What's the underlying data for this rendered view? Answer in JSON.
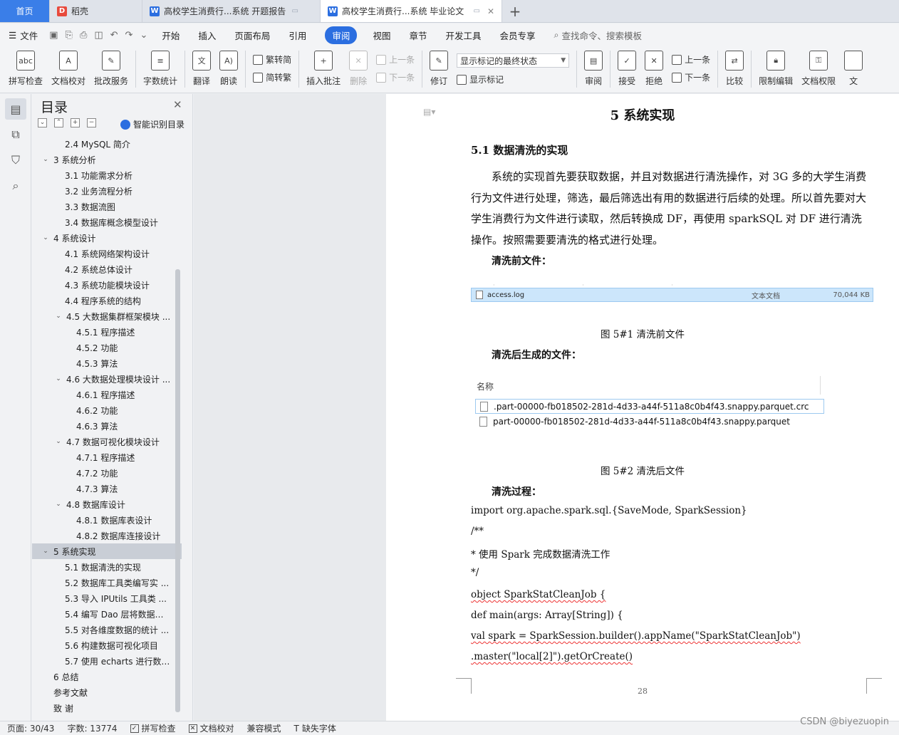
{
  "tabs": {
    "home": "首页",
    "wps": "稻壳",
    "doc1": "高校学生消费行...系统 开题报告",
    "doc2": "高校学生消费行...系统 毕业论文",
    "add": "+"
  },
  "menu": {
    "file": "文件",
    "items": [
      "开始",
      "插入",
      "页面布局",
      "引用",
      "审阅",
      "视图",
      "章节",
      "开发工具",
      "会员专享"
    ],
    "active_index": 4,
    "search": "查找命令、搜索模板"
  },
  "ribbon": {
    "spell": "拼写检查",
    "doc_check": "文档校对",
    "revise_service": "批改服务",
    "word_count": "字数统计",
    "translate": "翻译",
    "read_aloud": "朗读",
    "to_trad": "繁转简",
    "to_simp": "简转繁",
    "insert_comment": "插入批注",
    "delete": "删除",
    "prev": "上一条",
    "next": "下一条",
    "revise": "修订",
    "display_mode": "显示标记的最终状态",
    "show_markup": "显示标记",
    "review": "审阅",
    "accept": "接受",
    "reject": "拒绝",
    "prev2": "上一条",
    "next2": "下一条",
    "compare": "比较",
    "restrict": "限制编辑",
    "doc_perm": "文档权限",
    "doc_cut": "文"
  },
  "toc": {
    "title": "目录",
    "smart": "智能识别目录",
    "items": [
      {
        "level": 2,
        "text": "2.4 MySQL 简介",
        "toggle": ""
      },
      {
        "level": 1,
        "text": "3  系统分析",
        "toggle": "v"
      },
      {
        "level": 2,
        "text": "3.1  功能需求分析",
        "toggle": ""
      },
      {
        "level": 2,
        "text": "3.2  业务流程分析",
        "toggle": ""
      },
      {
        "level": 2,
        "text": "3.3  数据流图",
        "toggle": ""
      },
      {
        "level": 2,
        "text": "3.4  数据库概念模型设计",
        "toggle": ""
      },
      {
        "level": 1,
        "text": "4  系统设计",
        "toggle": "v"
      },
      {
        "level": 2,
        "text": "4.1  系统网络架构设计",
        "toggle": ""
      },
      {
        "level": 2,
        "text": "4.2  系统总体设计",
        "toggle": ""
      },
      {
        "level": 2,
        "text": "4.3  系统功能模块设计",
        "toggle": ""
      },
      {
        "level": 2,
        "text": "4.4  程序系统的结构",
        "toggle": ""
      },
      {
        "level": 2,
        "text": "4.5  大数据集群框架模块 ...",
        "toggle": "v"
      },
      {
        "level": 3,
        "text": "4.5.1  程序描述",
        "toggle": ""
      },
      {
        "level": 3,
        "text": "4.5.2  功能",
        "toggle": ""
      },
      {
        "level": 3,
        "text": "4.5.3  算法",
        "toggle": ""
      },
      {
        "level": 2,
        "text": "4.6  大数据处理模块设计 ...",
        "toggle": "v"
      },
      {
        "level": 3,
        "text": "4.6.1  程序描述",
        "toggle": ""
      },
      {
        "level": 3,
        "text": "4.6.2  功能",
        "toggle": ""
      },
      {
        "level": 3,
        "text": "4.6.3  算法",
        "toggle": ""
      },
      {
        "level": 2,
        "text": "4.7  数据可视化模块设计",
        "toggle": "v"
      },
      {
        "level": 3,
        "text": "4.7.1  程序描述",
        "toggle": ""
      },
      {
        "level": 3,
        "text": "4.7.2  功能",
        "toggle": ""
      },
      {
        "level": 3,
        "text": "4.7.3  算法",
        "toggle": ""
      },
      {
        "level": 2,
        "text": "4.8  数据库设计",
        "toggle": "v"
      },
      {
        "level": 3,
        "text": "4.8.1  数据库表设计",
        "toggle": ""
      },
      {
        "level": 3,
        "text": "4.8.2  数据库连接设计",
        "toggle": ""
      },
      {
        "level": 1,
        "text": "5  系统实现",
        "toggle": "v",
        "selected": true
      },
      {
        "level": 2,
        "text": "5.1  数据清洗的实现",
        "toggle": ""
      },
      {
        "level": 2,
        "text": "5.2  数据库工具类编写实 ...",
        "toggle": ""
      },
      {
        "level": 2,
        "text": "5.3 导入 IPUtils 工具类 ...",
        "toggle": ""
      },
      {
        "level": 2,
        "text": "5.4 编写 Dao 层将数据解 ...",
        "toggle": ""
      },
      {
        "level": 2,
        "text": "5.5  对各维度数据的统计 ...",
        "toggle": ""
      },
      {
        "level": 2,
        "text": "5.6  构建数据可视化项目",
        "toggle": ""
      },
      {
        "level": 2,
        "text": "5.7  使用 echarts 进行数 ...",
        "toggle": ""
      },
      {
        "level": 1,
        "text": "6  总结",
        "toggle": ""
      },
      {
        "level": 1,
        "text": "参考文献",
        "toggle": ""
      },
      {
        "level": 1,
        "text": "致    谢",
        "toggle": ""
      }
    ]
  },
  "document": {
    "h1": "5  系统实现",
    "h2": "5.1  数据清洗的实现",
    "para": "系统的实现首先要获取数据，并且对数据进行清洗操作，对 3G 多的大学生消费行为文件进行处理，筛选，最后筛选出有用的数据进行后续的处理。所以首先要对大学生消费行为文件进行读取，然后转换成 DF，再使用 sparkSQL 对 DF 进行清洗操作。按照需要要清洗的格式进行处理。",
    "label_before": "清洗前文件：",
    "fig1_file": {
      "name": "access.log",
      "type": "文本文档",
      "size": "70,044 KB"
    },
    "caption1": "图 5#1  清洗前文件",
    "label_after": "清洗后生成的文件：",
    "fig2_header": "名称",
    "fig2_files": [
      ".part-00000-fb018502-281d-4d33-a44f-511a8c0b4f43.snappy.parquet.crc",
      "part-00000-fb018502-281d-4d33-a44f-511a8c0b4f43.snappy.parquet"
    ],
    "caption2": "图 5#2  清洗后文件",
    "label_process": "清洗过程：",
    "code": [
      "import org.apache.spark.sql.{SaveMode, SparkSession}",
      "/**",
      "  *  使用 Spark 完成数据清洗工作",
      "  */",
      "object SparkStatCleanJob {",
      "  def main(args: Array[String]) {",
      "    val spark = SparkSession.builder().appName(\"SparkStatCleanJob\")",
      "      .master(\"local[2]\").getOrCreate()"
    ],
    "page_number": "28"
  },
  "status": {
    "page": "页面: 30/43",
    "words": "字数: 13774",
    "spell": "拼写检查",
    "doc_check": "文档校对",
    "compat": "兼容模式",
    "missing_font": "缺失字体"
  },
  "watermark": "CSDN @biyezuopin",
  "colors": {
    "accent": "#2b6ee0",
    "home_tab": "#3a7ee8",
    "selection": "#cce6fb"
  }
}
